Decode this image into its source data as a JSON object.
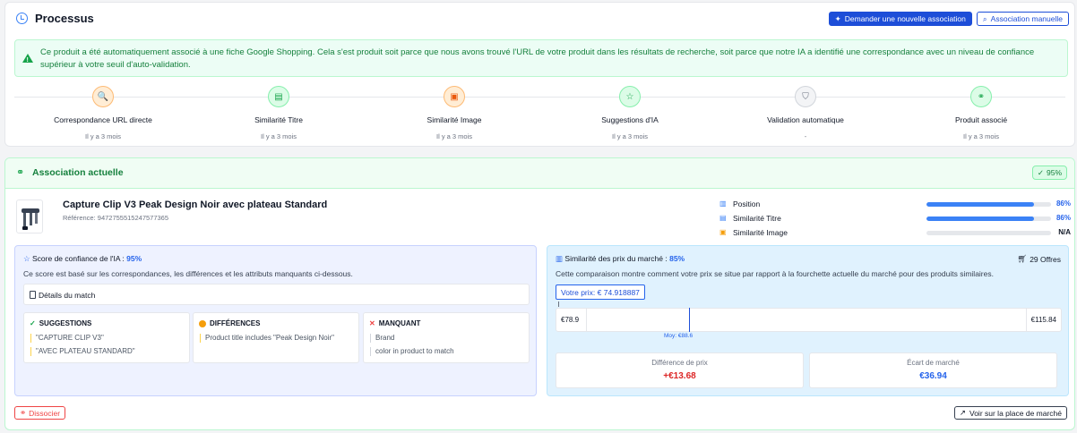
{
  "process": {
    "title": "Processus",
    "request_button": "Demander une nouvelle association",
    "manual_button": "Association manuelle",
    "alert": "Ce produit a été automatiquement associé à une fiche Google Shopping. Cela s'est produit soit parce que nous avons trouvé l'URL de votre produit dans les résultats de recherche, soit parce que notre IA a identifié une correspondance avec un niveau de confiance supérieur à votre seuil d'auto-validation.",
    "steps": [
      {
        "label": "Correspondance URL directe",
        "time": "Il y a 3 mois",
        "icon": "search-icon",
        "color": "#f97316",
        "bg": "#ffedd5",
        "border": "#fdba74",
        "glyph": "🔍"
      },
      {
        "label": "Similarité Titre",
        "time": "Il y a 3 mois",
        "icon": "document-icon",
        "color": "#16a34a",
        "bg": "#dcfce7",
        "border": "#86efac",
        "glyph": "▤"
      },
      {
        "label": "Similarité Image",
        "time": "Il y a 3 mois",
        "icon": "image-icon",
        "color": "#ea580c",
        "bg": "#ffedd5",
        "border": "#fdba74",
        "glyph": "▣"
      },
      {
        "label": "Suggestions d'IA",
        "time": "Il y a 3 mois",
        "icon": "star-icon",
        "color": "#16a34a",
        "bg": "#dcfce7",
        "border": "#86efac",
        "glyph": "☆"
      },
      {
        "label": "Validation automatique",
        "time": "-",
        "icon": "shield-check-icon",
        "color": "#6b7280",
        "bg": "#f3f4f6",
        "border": "#d1d5db",
        "glyph": "⛉"
      },
      {
        "label": "Produit associé",
        "time": "Il y a 3 mois",
        "icon": "link-icon",
        "color": "#16a34a",
        "bg": "#dcfce7",
        "border": "#86efac",
        "glyph": "⚭"
      }
    ]
  },
  "association": {
    "title": "Association actuelle",
    "score_badge": "95%",
    "product_name": "Capture Clip V3 Peak Design Noir avec plateau Standard",
    "reference": "Référence: 9472755515247577365",
    "metrics": [
      {
        "label": "Position",
        "value": "86%",
        "level": 0.86,
        "icon": "bar-chart-icon"
      },
      {
        "label": "Similarité Titre",
        "value": "86%",
        "level": 0.86,
        "icon": "document-icon"
      },
      {
        "label": "Similarité Image",
        "value": "N/A",
        "level": 0,
        "icon": "image-icon"
      }
    ],
    "ai": {
      "title_prefix": "Score de confiance de l'IA : ",
      "title_value": "95%",
      "desc": "Ce score est basé sur les correspondances, les différences et les attributs manquants ci-dessous.",
      "details": "Détails du match",
      "suggestions_head": "SUGGESTIONS",
      "suggestions": [
        "\"CAPTURE CLIP V3\"",
        "\"AVEC PLATEAU STANDARD\""
      ],
      "differences_head": "DIFFÉRENCES",
      "differences": [
        "Product title includes \"Peak Design Noir\""
      ],
      "missing_head": "MANQUANT",
      "missing": [
        "Brand",
        "color in product to match"
      ]
    },
    "market": {
      "title_prefix": "Similarité des prix du marché : ",
      "title_value": "85%",
      "offers": "29 Offres",
      "desc": "Cette comparaison montre comment votre prix se situe par rapport à la fourchette actuelle du marché pour des produits similaires.",
      "your_price": "Votre prix: € 74.918887",
      "min": "€78.9",
      "max": "€115.84",
      "avg": "Moy: €88.6",
      "diff_label": "Différence de prix",
      "diff_value": "+€13.68",
      "gap_label": "Écart de marché",
      "gap_value": "€36.94"
    },
    "dissociate_button": "Dissocier",
    "marketplace_button": "Voir sur la place de marché"
  },
  "colors": {
    "accent": "#1d4ed8",
    "success": "#16a34a",
    "danger": "#dc2626"
  }
}
